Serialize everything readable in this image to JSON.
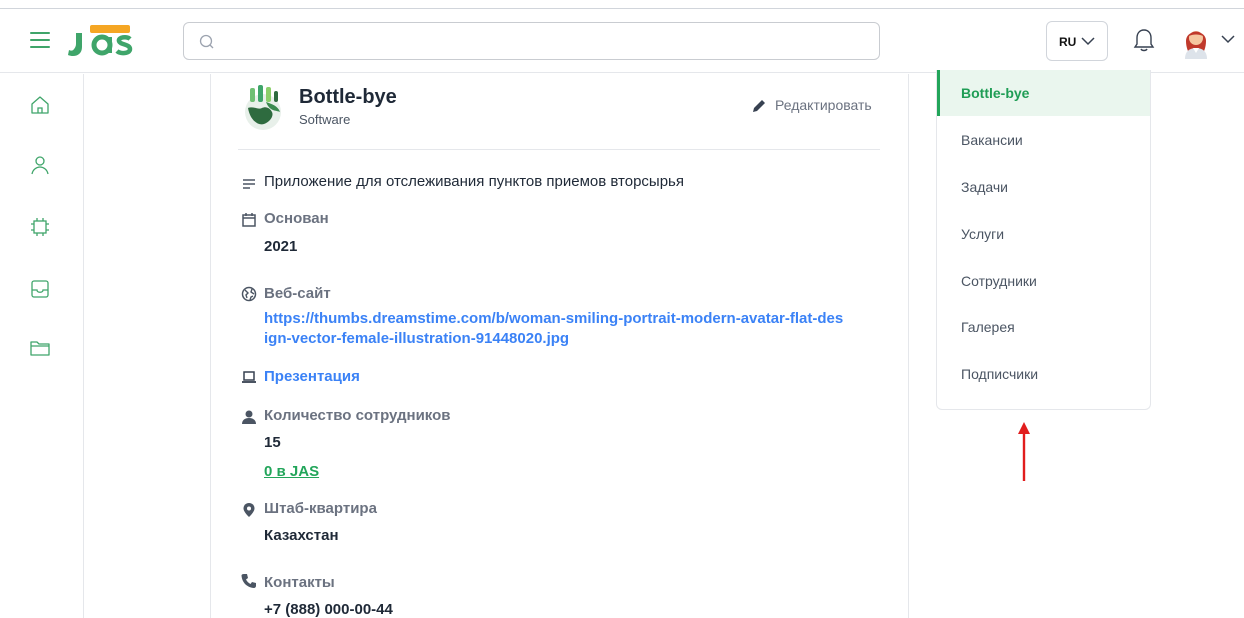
{
  "header": {
    "search_placeholder": "",
    "language": "RU"
  },
  "company": {
    "name": "Bottle-bye",
    "type": "Software",
    "edit_label": "Редактировать",
    "description": "Приложение для отслеживания пунктов приемов вторсырья",
    "founded_label": "Основан",
    "founded_value": "2021",
    "website_label": "Веб-сайт",
    "website_line1": "https://thumbs.dreamstime.com/b/woman-smiling-portrait-modern-avatar-flat-des",
    "website_line2": "ign-vector-female-illustration-91448020.jpg",
    "presentation_label": "Презентация",
    "employees_label": "Количество сотрудников",
    "employees_value": "15",
    "employees_in_jas": "0 в JAS",
    "hq_label": "Штаб-квартира",
    "hq_value": "Казахстан",
    "contacts_label": "Контакты",
    "contacts_value": "+7 (888) 000-00-44"
  },
  "side_menu": {
    "items": [
      {
        "label": "Bottle-bye",
        "active": true
      },
      {
        "label": "Вакансии"
      },
      {
        "label": "Задачи"
      },
      {
        "label": "Услуги"
      },
      {
        "label": "Сотрудники"
      },
      {
        "label": "Галерея"
      },
      {
        "label": "Подписчики"
      }
    ]
  },
  "colors": {
    "brand_green": "#22a55a",
    "link_blue": "#3b82f6",
    "annotation_red": "#e11d1d"
  },
  "icons": [
    "menu-icon",
    "search-icon",
    "chevron-down-icon",
    "bell-icon",
    "home-icon",
    "user-icon",
    "chip-icon",
    "inbox-icon",
    "folder-icon",
    "pencil-icon",
    "text-lines-icon",
    "calendar-icon",
    "globe-icon",
    "laptop-icon",
    "person-icon",
    "location-pin-icon",
    "phone-icon"
  ]
}
